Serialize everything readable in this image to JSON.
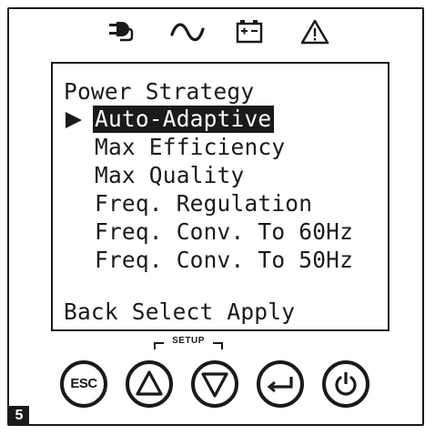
{
  "status_bar": {
    "icons": [
      "plug-icon",
      "ac-wave-icon",
      "battery-icon",
      "warning-icon"
    ]
  },
  "lcd": {
    "title": "Power Strategy",
    "menu_items": [
      {
        "label": "Auto-Adaptive",
        "selected": true
      },
      {
        "label": "Max Efficiency",
        "selected": false
      },
      {
        "label": "Max Quality",
        "selected": false
      },
      {
        "label": "Freq. Regulation",
        "selected": false
      },
      {
        "label": "Freq. Conv. To 60Hz",
        "selected": false
      },
      {
        "label": "Freq. Conv. To 50Hz",
        "selected": false
      }
    ],
    "footer": "Back Select Apply"
  },
  "controls": {
    "setup_label": "SETUP",
    "esc_label": "ESC"
  },
  "step_badge": "5"
}
